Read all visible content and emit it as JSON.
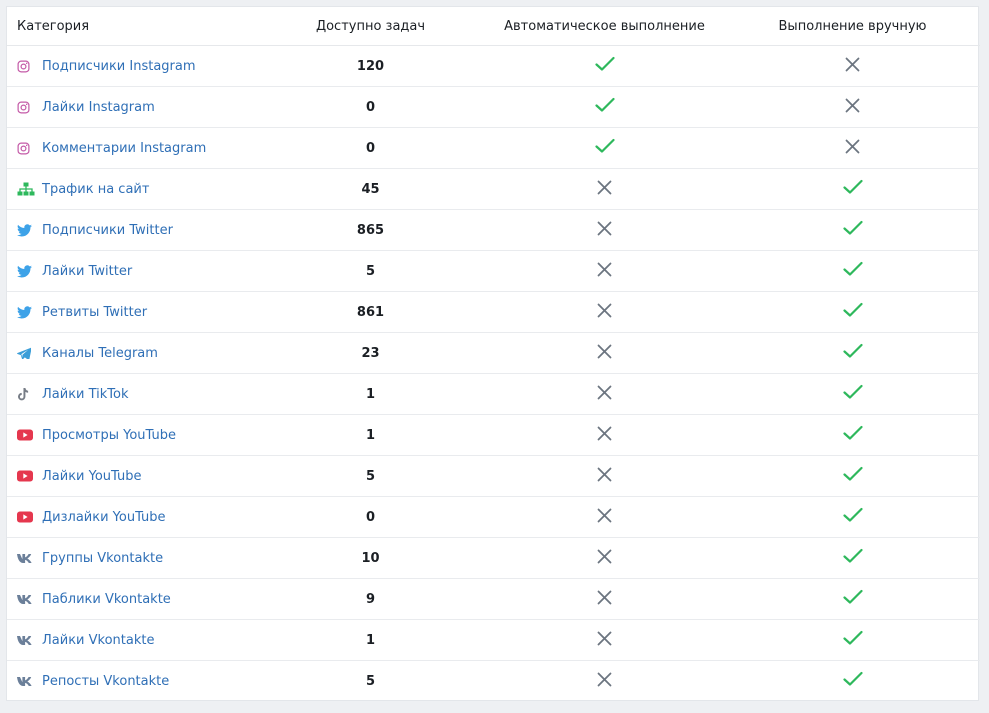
{
  "table": {
    "headers": {
      "category": "Категория",
      "available": "Доступно задач",
      "auto": "Автоматическое выполнение",
      "manual": "Выполнение вручную"
    },
    "colors": {
      "check": "#2eb85c",
      "cross": "#6c7580",
      "link": "#2f6fb6"
    },
    "rows": [
      {
        "icon": "instagram-icon",
        "label": "Подписчики Instagram",
        "count": "120",
        "auto": "check",
        "manual": "cross"
      },
      {
        "icon": "instagram-icon",
        "label": "Лайки Instagram",
        "count": "0",
        "auto": "check",
        "manual": "cross"
      },
      {
        "icon": "instagram-icon",
        "label": "Комментарии Instagram",
        "count": "0",
        "auto": "check",
        "manual": "cross"
      },
      {
        "icon": "sitemap-icon",
        "label": "Трафик на сайт",
        "count": "45",
        "auto": "cross",
        "manual": "check"
      },
      {
        "icon": "twitter-icon",
        "label": "Подписчики Twitter",
        "count": "865",
        "auto": "cross",
        "manual": "check"
      },
      {
        "icon": "twitter-icon",
        "label": "Лайки Twitter",
        "count": "5",
        "auto": "cross",
        "manual": "check"
      },
      {
        "icon": "twitter-icon",
        "label": "Ретвиты Twitter",
        "count": "861",
        "auto": "cross",
        "manual": "check"
      },
      {
        "icon": "telegram-icon",
        "label": "Каналы Telegram",
        "count": "23",
        "auto": "cross",
        "manual": "check"
      },
      {
        "icon": "tiktok-icon",
        "label": "Лайки TikTok",
        "count": "1",
        "auto": "cross",
        "manual": "check"
      },
      {
        "icon": "youtube-icon",
        "label": "Просмотры YouTube",
        "count": "1",
        "auto": "cross",
        "manual": "check"
      },
      {
        "icon": "youtube-icon",
        "label": "Лайки YouTube",
        "count": "5",
        "auto": "cross",
        "manual": "check"
      },
      {
        "icon": "youtube-icon",
        "label": "Дизлайки YouTube",
        "count": "0",
        "auto": "cross",
        "manual": "check"
      },
      {
        "icon": "vk-icon",
        "label": "Группы Vkontakte",
        "count": "10",
        "auto": "cross",
        "manual": "check"
      },
      {
        "icon": "vk-icon",
        "label": "Паблики Vkontakte",
        "count": "9",
        "auto": "cross",
        "manual": "check"
      },
      {
        "icon": "vk-icon",
        "label": "Лайки Vkontakte",
        "count": "1",
        "auto": "cross",
        "manual": "check"
      },
      {
        "icon": "vk-icon",
        "label": "Репосты Vkontakte",
        "count": "5",
        "auto": "cross",
        "manual": "check"
      }
    ]
  }
}
